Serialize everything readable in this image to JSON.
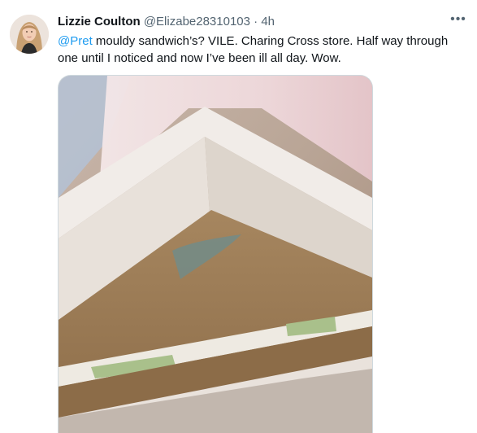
{
  "tweet": {
    "author_name": "Lizzie Coulton",
    "author_handle": "@Elizabe28310103",
    "separator": "·",
    "timestamp": "4h",
    "more_label": "•••",
    "mention": "@Pret",
    "body_text": " mouldy sandwich’s? VILE. Charing Cross store. Half way through one until I noticed and now I’ve been ill all day. Wow."
  },
  "icons": {
    "more": "more-options-icon",
    "avatar": "profile-avatar"
  },
  "colors": {
    "link": "#1d9bf0",
    "secondary_text": "#536471",
    "primary_text": "#0f1419",
    "border": "#cfd9de"
  }
}
